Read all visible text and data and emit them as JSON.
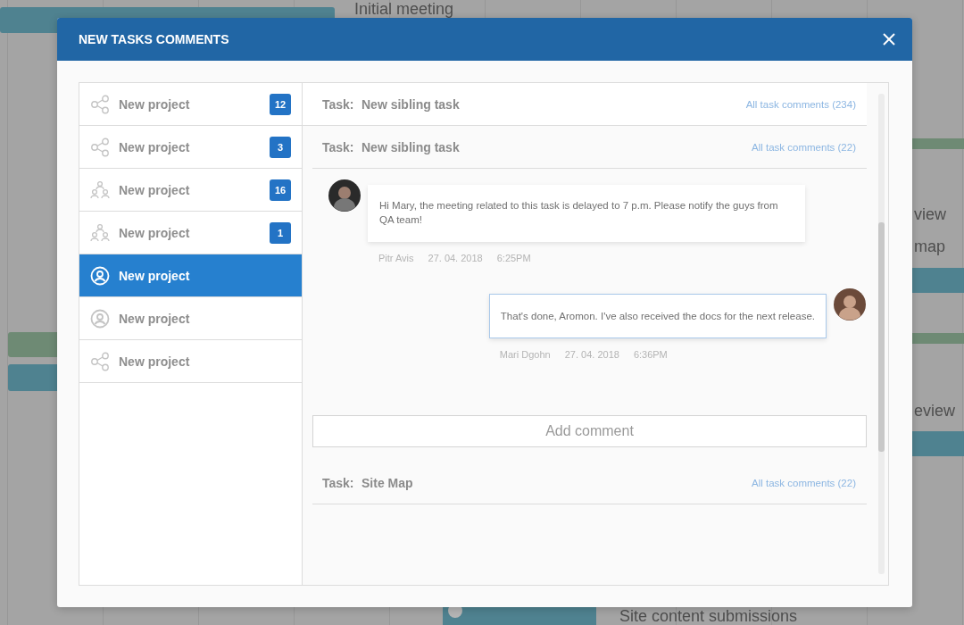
{
  "backdrop": {
    "top_label": "Initial meeting",
    "side_labels": [
      "view",
      "map",
      "eview"
    ],
    "bottom_label": "Site content submissions"
  },
  "dialog": {
    "title": "NEW TASKS COMMENTS",
    "projects": [
      {
        "kind": "share",
        "name": "New project",
        "count": "12",
        "selected": false
      },
      {
        "kind": "share",
        "name": "New project",
        "count": "3",
        "selected": false
      },
      {
        "kind": "team",
        "name": "New project",
        "count": "16",
        "selected": false
      },
      {
        "kind": "team",
        "name": "New project",
        "count": "1",
        "selected": false
      },
      {
        "kind": "user",
        "name": "New project",
        "selected": true
      },
      {
        "kind": "user",
        "name": "New project",
        "selected": false
      },
      {
        "kind": "share",
        "name": "New project",
        "selected": false
      }
    ],
    "tasks": [
      {
        "label": "Task:",
        "name": "New sibling task",
        "link": "All task comments (234)"
      },
      {
        "label": "Task:",
        "name": "New sibling task",
        "link": "All task comments (22)",
        "comments": [
          {
            "kind": "incoming",
            "text": "Hi Mary, the meeting related to this task is delayed to 7 p.m. Please notify the guys from QA team!",
            "author": "Pitr Avis",
            "date": "27. 04. 2018",
            "time": "6:25PM"
          },
          {
            "kind": "outgoing",
            "text": "That's done, Aromon. I've also received the docs for the next release.",
            "author": "Mari Dgohn",
            "date": "27. 04. 2018",
            "time": "6:36PM"
          }
        ],
        "input": {
          "placeholder": "Add comment"
        }
      },
      {
        "label": "Task:",
        "name": "Site Map",
        "link": "All task comments (22)"
      }
    ]
  }
}
